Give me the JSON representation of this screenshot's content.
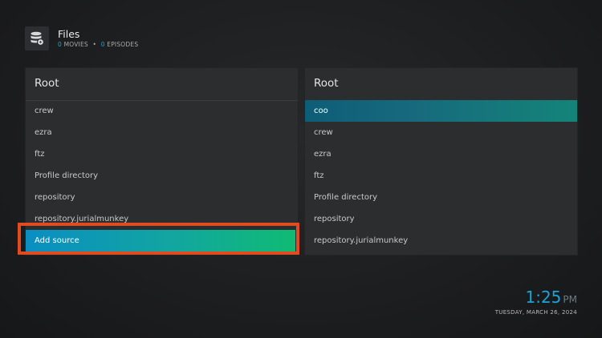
{
  "header": {
    "title": "Files",
    "movies_count": "0",
    "movies_label": "MOVIES",
    "separator": "•",
    "episodes_count": "0",
    "episodes_label": "EPISODES",
    "icon": "database-icon"
  },
  "left_panel": {
    "title": "Root",
    "items": [
      {
        "label": "crew"
      },
      {
        "label": "ezra"
      },
      {
        "label": "ftz"
      },
      {
        "label": "Profile directory"
      },
      {
        "label": "repository"
      },
      {
        "label": "repository.jurialmunkey"
      }
    ],
    "add_source_label": "Add source"
  },
  "right_panel": {
    "title": "Root",
    "items": [
      {
        "label": "coo"
      },
      {
        "label": "crew"
      },
      {
        "label": "ezra"
      },
      {
        "label": "ftz"
      },
      {
        "label": "Profile directory"
      },
      {
        "label": "repository"
      },
      {
        "label": "repository.jurialmunkey"
      }
    ]
  },
  "clock": {
    "time": "1:25",
    "ampm": "PM",
    "date": "TUESDAY, MARCH 26, 2024"
  },
  "colors": {
    "accent": "#17a6d8",
    "highlight_border": "#e24a1f",
    "add_source_start": "#0a8ec2",
    "add_source_end": "#10bb73"
  }
}
